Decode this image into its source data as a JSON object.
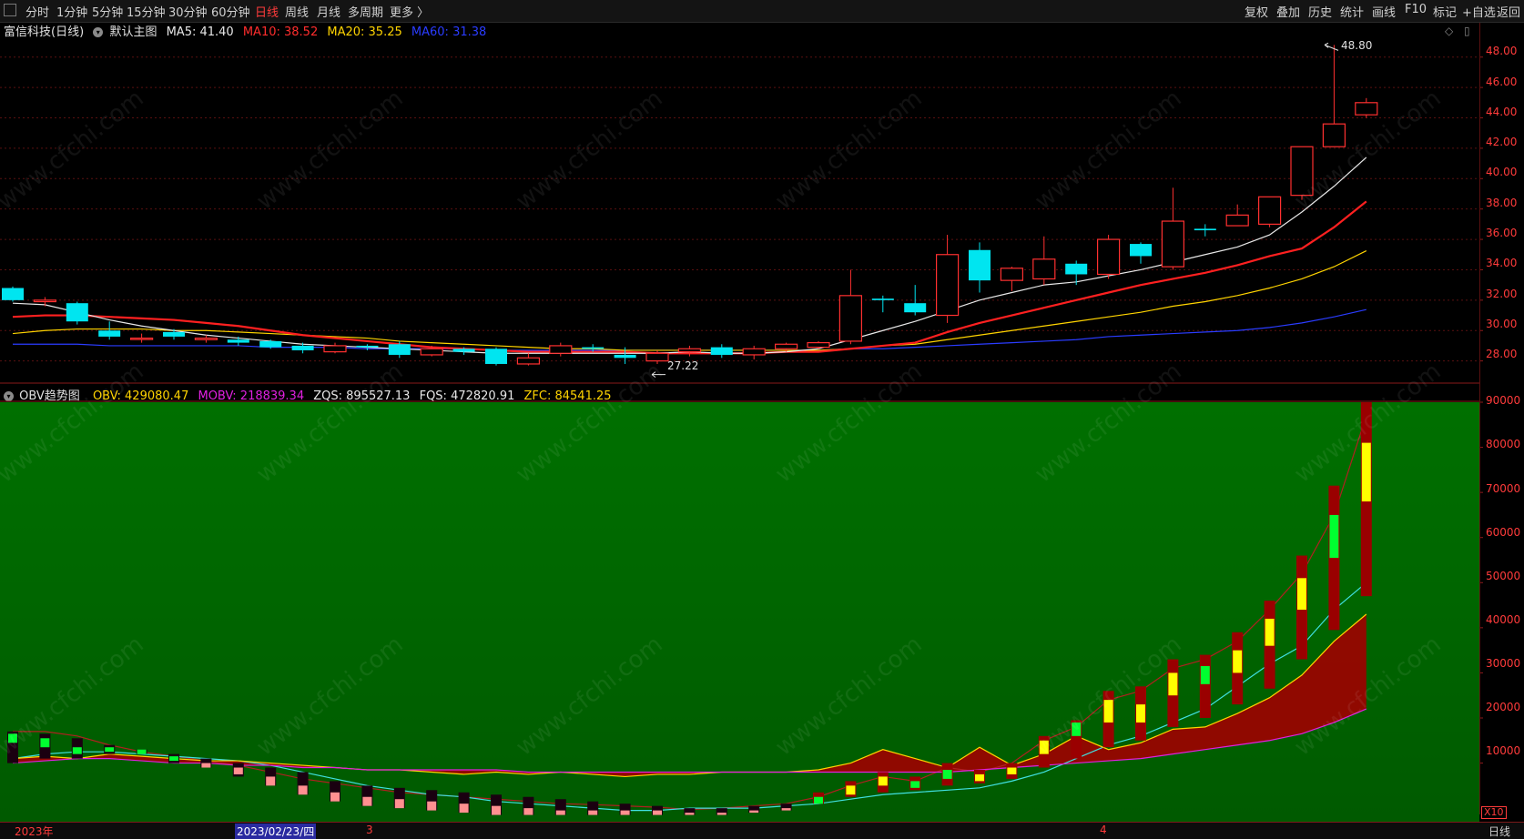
{
  "toolbar": {
    "periods": [
      "分时",
      "1分钟",
      "5分钟",
      "15分钟",
      "30分钟",
      "60分钟",
      "日线",
      "周线",
      "月线",
      "多周期",
      "更多 〉"
    ],
    "active_period": "日线",
    "right_buttons": [
      "复权",
      "叠加",
      "历史",
      "统计",
      "画线",
      "F10",
      "标记",
      "+自选",
      "返回"
    ]
  },
  "main_chart": {
    "stock_title": "富信科技(日线)",
    "indicator_name": "默认主图",
    "ma_labels": [
      {
        "text": "MA5: 41.40",
        "color": "#e8e8e8"
      },
      {
        "text": "MA10: 38.52",
        "color": "#ff2d2d"
      },
      {
        "text": "MA20: 35.25",
        "color": "#ffd400"
      },
      {
        "text": "MA60: 31.38",
        "color": "#2a3cff"
      }
    ],
    "high_label": "48.80",
    "low_label": "27.22",
    "y_ticks": [
      "48.00",
      "46.00",
      "44.00",
      "42.00",
      "40.00",
      "38.00",
      "36.00",
      "34.00",
      "32.00",
      "30.00",
      "28.00"
    ],
    "y_range": [
      26.6,
      50.2
    ],
    "candles": [
      [
        32.8,
        32.0,
        32.9,
        31.9
      ],
      [
        31.9,
        32.0,
        32.2,
        31.6
      ],
      [
        31.8,
        30.6,
        31.9,
        30.4
      ],
      [
        30.0,
        29.6,
        30.6,
        29.4
      ],
      [
        29.5,
        29.5,
        29.8,
        29.2
      ],
      [
        29.9,
        29.6,
        30.1,
        29.4
      ],
      [
        29.4,
        29.5,
        29.7,
        29.2
      ],
      [
        29.4,
        29.2,
        29.6,
        29.0
      ],
      [
        29.3,
        28.9,
        29.4,
        28.8
      ],
      [
        29.0,
        28.7,
        29.2,
        28.5
      ],
      [
        28.6,
        29.0,
        29.2,
        28.5
      ],
      [
        29.0,
        28.9,
        29.1,
        28.7
      ],
      [
        29.1,
        28.4,
        29.3,
        28.2
      ],
      [
        28.4,
        28.8,
        29.0,
        28.3
      ],
      [
        28.8,
        28.6,
        28.9,
        28.4
      ],
      [
        28.8,
        27.8,
        28.9,
        27.7
      ],
      [
        27.8,
        28.2,
        28.5,
        27.7
      ],
      [
        28.5,
        29.0,
        29.2,
        28.3
      ],
      [
        28.9,
        28.8,
        29.1,
        28.6
      ],
      [
        28.4,
        28.2,
        28.9,
        27.8
      ],
      [
        28.0,
        28.5,
        28.7,
        27.8
      ],
      [
        28.6,
        28.8,
        29.0,
        28.3
      ],
      [
        28.9,
        28.4,
        29.1,
        28.2
      ],
      [
        28.4,
        28.8,
        29.0,
        28.1
      ],
      [
        28.8,
        29.1,
        29.2,
        28.6
      ],
      [
        28.9,
        29.2,
        29.3,
        28.8
      ],
      [
        29.3,
        32.3,
        34.0,
        29.1
      ],
      [
        32.1,
        32.0,
        32.3,
        31.2
      ],
      [
        31.8,
        31.2,
        33.0,
        31.0
      ],
      [
        31.0,
        35.0,
        36.3,
        30.5
      ],
      [
        35.3,
        33.3,
        35.8,
        32.5
      ],
      [
        33.3,
        34.1,
        34.2,
        32.6
      ],
      [
        33.4,
        34.7,
        36.2,
        33.0
      ],
      [
        34.4,
        33.7,
        34.6,
        33.0
      ],
      [
        33.7,
        36.0,
        36.3,
        33.4
      ],
      [
        35.7,
        34.9,
        35.8,
        34.4
      ],
      [
        34.2,
        37.2,
        39.4,
        34.0
      ],
      [
        36.7,
        36.6,
        37.0,
        36.2
      ],
      [
        36.9,
        37.6,
        38.3,
        36.9
      ],
      [
        37.0,
        38.8,
        38.8,
        36.8
      ],
      [
        38.9,
        42.1,
        42.1,
        38.6
      ],
      [
        42.1,
        43.6,
        48.8,
        42.1
      ],
      [
        44.2,
        45.0,
        45.3,
        44.0
      ]
    ],
    "ma5": [
      31.8,
      31.7,
      31.2,
      30.7,
      30.3,
      30.0,
      29.7,
      29.5,
      29.3,
      29.1,
      29.0,
      28.9,
      28.8,
      28.7,
      28.6,
      28.5,
      28.5,
      28.5,
      28.5,
      28.5,
      28.5,
      28.6,
      28.5,
      28.5,
      28.6,
      28.8,
      29.4,
      30.0,
      30.6,
      31.3,
      32.0,
      32.5,
      33.0,
      33.2,
      33.6,
      34.0,
      34.5,
      35.0,
      35.5,
      36.3,
      37.8,
      39.5,
      41.4
    ],
    "ma10": [
      30.9,
      31.0,
      31.0,
      30.9,
      30.8,
      30.7,
      30.5,
      30.3,
      30.0,
      29.7,
      29.5,
      29.3,
      29.1,
      28.9,
      28.8,
      28.7,
      28.6,
      28.6,
      28.6,
      28.6,
      28.5,
      28.5,
      28.5,
      28.5,
      28.6,
      28.6,
      28.8,
      29.0,
      29.2,
      29.9,
      30.5,
      31.0,
      31.5,
      32.0,
      32.5,
      33.0,
      33.4,
      33.8,
      34.3,
      34.9,
      35.4,
      36.8,
      38.5
    ],
    "ma20": [
      29.8,
      30.0,
      30.1,
      30.1,
      30.1,
      30.0,
      30.0,
      29.9,
      29.8,
      29.7,
      29.6,
      29.5,
      29.3,
      29.2,
      29.1,
      29.0,
      28.9,
      28.8,
      28.8,
      28.7,
      28.7,
      28.7,
      28.7,
      28.7,
      28.7,
      28.7,
      28.8,
      29.0,
      29.1,
      29.4,
      29.7,
      30.0,
      30.3,
      30.6,
      30.9,
      31.2,
      31.6,
      31.9,
      32.3,
      32.8,
      33.4,
      34.2,
      35.25
    ],
    "ma60": [
      29.1,
      29.1,
      29.1,
      29.0,
      29.0,
      29.0,
      29.0,
      29.0,
      28.9,
      28.9,
      28.9,
      28.8,
      28.8,
      28.8,
      28.8,
      28.7,
      28.7,
      28.7,
      28.7,
      28.7,
      28.7,
      28.7,
      28.7,
      28.7,
      28.7,
      28.7,
      28.8,
      28.8,
      28.9,
      29.0,
      29.1,
      29.2,
      29.3,
      29.4,
      29.6,
      29.7,
      29.8,
      29.9,
      30.0,
      30.2,
      30.5,
      30.9,
      31.38
    ]
  },
  "sub_chart": {
    "name": "OBV趋势图",
    "labels": [
      {
        "text": "OBV: 429080.47",
        "color": "#ffd400"
      },
      {
        "text": "MOBV: 218839.34",
        "color": "#e020e0"
      },
      {
        "text": "ZQS: 895527.13",
        "color": "#e8e8e8"
      },
      {
        "text": "FQS: 472820.91",
        "color": "#e8e8e8"
      },
      {
        "text": "ZFC: 84541.25",
        "color": "#ffd400"
      }
    ],
    "y_ticks": [
      "90000",
      "80000",
      "70000",
      "60000",
      "50000",
      "40000",
      "30000",
      "20000",
      "10000"
    ],
    "y_range": [
      -3000,
      90000
    ],
    "x10_label": "X10",
    "bars": [
      [
        17000,
        10000,
        14500,
        16500
      ],
      [
        16500,
        11000,
        13500,
        15500
      ],
      [
        15500,
        11000,
        12000,
        13500
      ],
      [
        14000,
        12000,
        12500,
        13500
      ],
      [
        13000,
        12000,
        12000,
        13000
      ],
      [
        12000,
        10000,
        10500,
        11500
      ],
      [
        11000,
        9000,
        9000,
        10000
      ],
      [
        10000,
        7000,
        7500,
        9000
      ],
      [
        9000,
        5000,
        5000,
        7000
      ],
      [
        8000,
        3000,
        3000,
        5000
      ],
      [
        6000,
        1500,
        1500,
        3500
      ],
      [
        5000,
        500,
        500,
        2500
      ],
      [
        4500,
        0,
        0,
        2000
      ],
      [
        4000,
        -500,
        -500,
        1500
      ],
      [
        3500,
        -1000,
        -1000,
        1000
      ],
      [
        3000,
        -1500,
        -1500,
        500
      ],
      [
        2500,
        -1500,
        -1500,
        0
      ],
      [
        2000,
        -1500,
        -1500,
        -500
      ],
      [
        1500,
        -1500,
        -1500,
        -500
      ],
      [
        1000,
        -1500,
        -1500,
        -500
      ],
      [
        500,
        -1500,
        -1500,
        -500
      ],
      [
        0,
        -1500,
        -1500,
        -1000
      ],
      [
        0,
        -1500,
        -1500,
        -1000
      ],
      [
        500,
        -1000,
        -1000,
        -500
      ],
      [
        1000,
        -500,
        -500,
        0
      ],
      [
        3500,
        1000,
        1000,
        2500
      ],
      [
        6000,
        2500,
        3000,
        5000
      ],
      [
        8000,
        3500,
        5000,
        7000
      ],
      [
        7000,
        4000,
        4500,
        6000
      ],
      [
        10000,
        5000,
        6500,
        8500
      ],
      [
        8500,
        5500,
        6000,
        7500
      ],
      [
        10000,
        6500,
        7500,
        9000
      ],
      [
        16000,
        9000,
        12000,
        15000
      ],
      [
        19500,
        11000,
        16000,
        19000
      ],
      [
        26000,
        13500,
        19000,
        24000
      ],
      [
        27000,
        15000,
        19000,
        23000
      ],
      [
        33000,
        18000,
        25000,
        30000
      ],
      [
        34000,
        20000,
        27500,
        31500
      ],
      [
        39000,
        23000,
        30000,
        35000
      ],
      [
        46000,
        26500,
        36000,
        42000
      ],
      [
        56000,
        33000,
        44000,
        51000
      ],
      [
        71500,
        39500,
        55500,
        65000
      ],
      [
        90000,
        47000,
        68000,
        81000
      ]
    ],
    "obv": [
      11000,
      11500,
      11000,
      12000,
      11500,
      11000,
      10500,
      10500,
      10000,
      9500,
      9000,
      8500,
      8500,
      8000,
      7500,
      8000,
      7500,
      8000,
      7500,
      7000,
      7500,
      7500,
      8000,
      8000,
      8000,
      8500,
      10000,
      13000,
      11000,
      9000,
      13500,
      9500,
      12000,
      16000,
      13000,
      14500,
      17500,
      18000,
      21000,
      24500,
      29500,
      37000,
      43000
    ],
    "mobv": [
      10000,
      10500,
      11000,
      11000,
      10500,
      10000,
      10000,
      9500,
      9500,
      9000,
      9000,
      8500,
      8500,
      8500,
      8500,
      8500,
      8000,
      8000,
      8000,
      8000,
      8000,
      8000,
      8000,
      8000,
      8000,
      8000,
      8000,
      8000,
      8000,
      8000,
      8500,
      9000,
      9500,
      10000,
      10500,
      11000,
      12000,
      13000,
      14000,
      15000,
      16500,
      19000,
      22000
    ],
    "zqs": [
      17000,
      17000,
      16000,
      14000,
      12500,
      11500,
      10500,
      9500,
      8000,
      6500,
      5500,
      4500,
      3500,
      3000,
      2500,
      2000,
      1500,
      1000,
      800,
      500,
      200,
      -300,
      0,
      500,
      1000,
      2500,
      5000,
      7000,
      6000,
      9000,
      8000,
      10000,
      15000,
      18000,
      24000,
      26000,
      31000,
      33000,
      37000,
      44000,
      52000,
      65000,
      87000
    ],
    "fqs": [
      11000,
      12000,
      12500,
      12500,
      12000,
      11500,
      11000,
      10500,
      9500,
      8000,
      6500,
      5000,
      4000,
      3000,
      2500,
      1500,
      1000,
      500,
      0,
      -500,
      -500,
      0,
      0,
      0,
      500,
      1000,
      2000,
      3000,
      3500,
      4000,
      4500,
      6000,
      8000,
      11000,
      14000,
      16000,
      19000,
      22000,
      27000,
      32000,
      36000,
      44000,
      50000
    ]
  },
  "x_axis": {
    "labels": [
      {
        "text": "2023年",
        "color": "#ff3b3b"
      },
      {
        "text": "2023/02/23/四",
        "color": "#ffffff"
      },
      {
        "text": "3",
        "color": "#ff3b3b"
      },
      {
        "text": "4",
        "color": "#ff3b3b"
      }
    ],
    "period_label": "日线"
  },
  "colors": {
    "up": "#ff3030",
    "down": "#00e5f0",
    "sub_bg_top": "#007000",
    "sub_bg_bottom": "#005a00"
  },
  "watermark": "www.cfchi.com"
}
